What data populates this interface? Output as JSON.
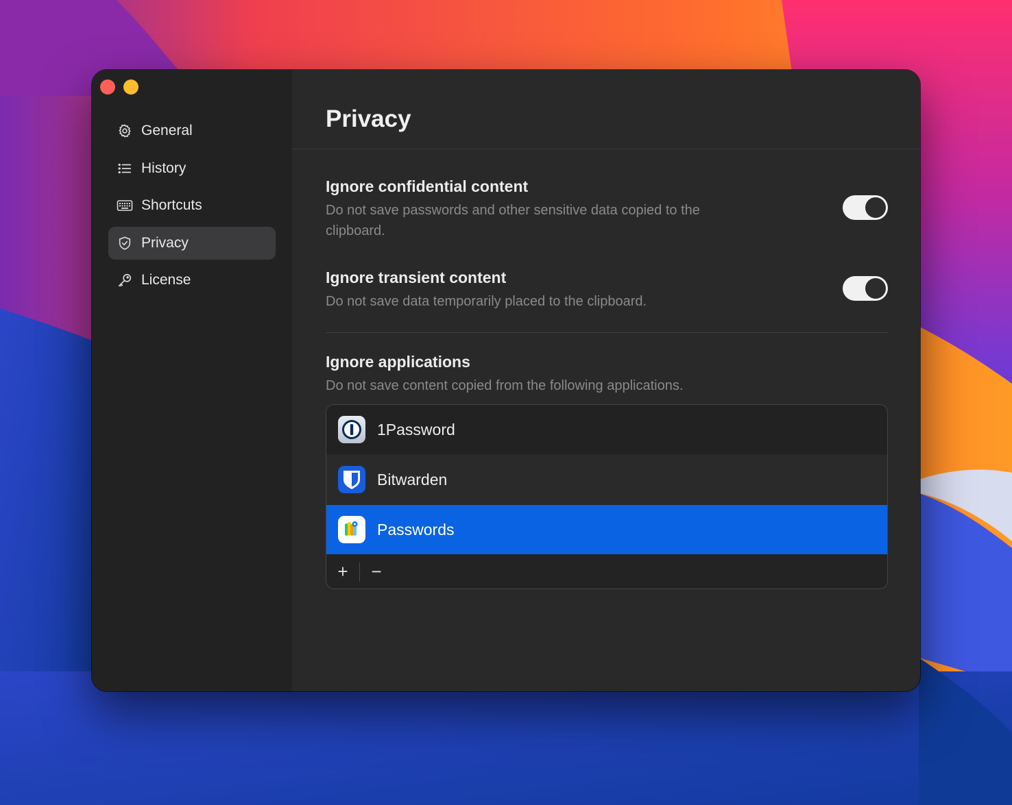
{
  "window": {
    "traffic_lights": [
      "close",
      "minimize"
    ]
  },
  "sidebar": {
    "items": [
      {
        "label": "General",
        "icon": "gear-icon",
        "active": false
      },
      {
        "label": "History",
        "icon": "list-icon",
        "active": false
      },
      {
        "label": "Shortcuts",
        "icon": "keyboard-icon",
        "active": false
      },
      {
        "label": "Privacy",
        "icon": "shield-icon",
        "active": true
      },
      {
        "label": "License",
        "icon": "key-icon",
        "active": false
      }
    ]
  },
  "main": {
    "title": "Privacy",
    "settings": [
      {
        "title": "Ignore confidential content",
        "description": "Do not save passwords and other sensitive data copied to the clipboard.",
        "enabled": true
      },
      {
        "title": "Ignore transient content",
        "description": "Do not save data temporarily placed to the clipboard.",
        "enabled": true
      }
    ],
    "ignore_apps": {
      "title": "Ignore applications",
      "description": "Do not save content copied from the following applications.",
      "apps": [
        {
          "name": "1Password",
          "icon": "onepassword-app-icon",
          "selected": false
        },
        {
          "name": "Bitwarden",
          "icon": "bitwarden-app-icon",
          "selected": false
        },
        {
          "name": "Passwords",
          "icon": "passwords-app-icon",
          "selected": true
        }
      ],
      "add_label": "+",
      "remove_label": "−"
    }
  },
  "colors": {
    "accent": "#0a63e3",
    "window_bg": "#292929",
    "sidebar_bg": "#222222",
    "close": "#fe5f57",
    "minimize": "#febc2e"
  }
}
